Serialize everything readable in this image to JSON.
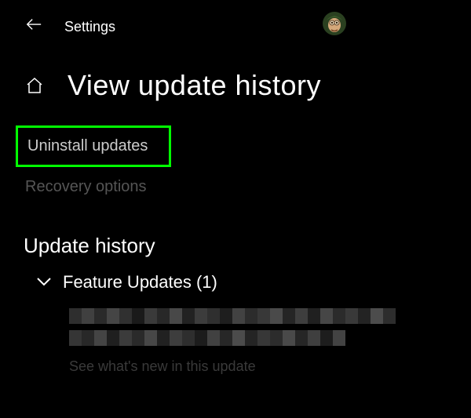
{
  "header": {
    "app_title": "Settings"
  },
  "page": {
    "title": "View update history"
  },
  "links": {
    "uninstall_label": "Uninstall updates",
    "recovery_label": "Recovery options"
  },
  "history": {
    "section_title": "Update history",
    "feature_updates_label": "Feature Updates (1)",
    "see_whats_new": "See what's new in this update"
  },
  "colors": {
    "highlight": "#00ff00"
  }
}
